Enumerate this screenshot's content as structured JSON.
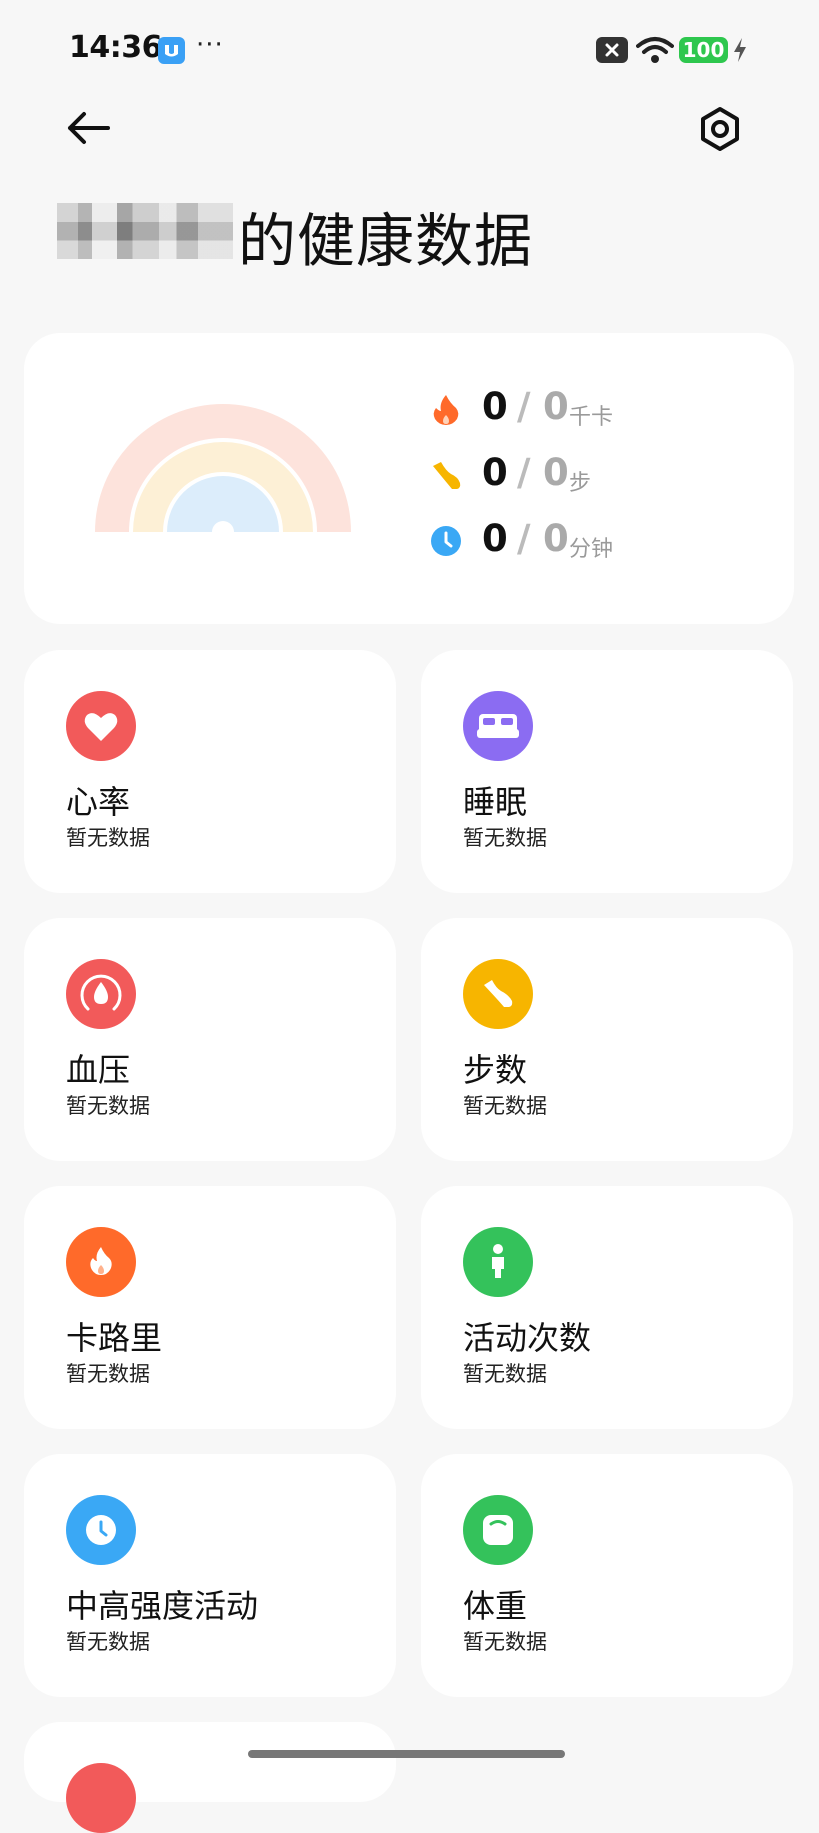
{
  "status_bar": {
    "time": "14:36",
    "more": "···",
    "battery": "100"
  },
  "header": {
    "title": "的健康数据"
  },
  "summary": {
    "metrics": [
      {
        "icon": "flame-icon",
        "color": "#ff6a2a",
        "current": "0",
        "slash": "/",
        "goal": "0",
        "unit": "千卡"
      },
      {
        "icon": "shoe-icon",
        "color": "#f7b500",
        "current": "0",
        "slash": "/",
        "goal": "0",
        "unit": "步"
      },
      {
        "icon": "clock-icon",
        "color": "#3aa8f5",
        "current": "0",
        "slash": "/",
        "goal": "0",
        "unit": "分钟"
      }
    ]
  },
  "tiles": [
    {
      "title": "心率",
      "sub": "暂无数据",
      "icon": "heart-icon",
      "color": "#f25a5a"
    },
    {
      "title": "睡眠",
      "sub": "暂无数据",
      "icon": "bed-icon",
      "color": "#8b6cf2"
    },
    {
      "title": "血压",
      "sub": "暂无数据",
      "icon": "blood-drop-icon",
      "color": "#f25a5a"
    },
    {
      "title": "步数",
      "sub": "暂无数据",
      "icon": "shoe-icon",
      "color": "#f7b500"
    },
    {
      "title": "卡路里",
      "sub": "暂无数据",
      "icon": "flame-icon",
      "color": "#ff6a2a"
    },
    {
      "title": "活动次数",
      "sub": "暂无数据",
      "icon": "person-icon",
      "color": "#34c25b"
    },
    {
      "title": "中高强度活动",
      "sub": "暂无数据",
      "icon": "clock-icon",
      "color": "#3aa8f5"
    },
    {
      "title": "体重",
      "sub": "暂无数据",
      "icon": "scale-icon",
      "color": "#34c25b"
    }
  ]
}
